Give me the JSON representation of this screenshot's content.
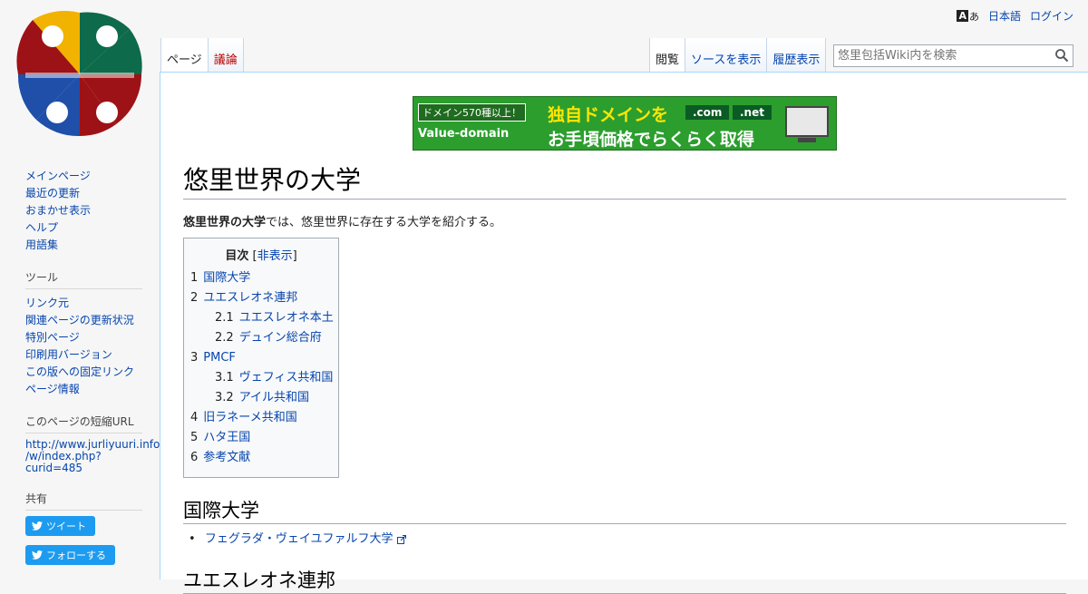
{
  "personal_tools": {
    "language": "日本語",
    "login": "ログイン"
  },
  "tabs": {
    "page": "ページ",
    "talk": "議論",
    "read": "閲覧",
    "view_source": "ソースを表示",
    "history": "履歴表示"
  },
  "search": {
    "placeholder": "悠里包括Wiki内を検索"
  },
  "sidebar": {
    "nav": [
      "メインページ",
      "最近の更新",
      "おまかせ表示",
      "ヘルプ",
      "用語集"
    ],
    "tools_heading": "ツール",
    "tools": [
      "リンク元",
      "関連ページの更新状況",
      "特別ページ",
      "印刷用バージョン",
      "この版への固定リンク",
      "ページ情報"
    ],
    "shorturl_heading": "このページの短縮URL",
    "shorturl": [
      "http://www.jurliyuuri.info",
      "/w/index.php?",
      "curid=485"
    ],
    "share_heading": "共有",
    "tweet": "ツイート",
    "follow": "フォローする"
  },
  "banner": {
    "badge": "ドメイン570種以上！",
    "brand": "Value-domain",
    "headline1": "独自ドメインを",
    "headline2": "お手頃価格でらくらく取得",
    "tld1": ".com",
    "tld2": ".net"
  },
  "article": {
    "title": "悠里世界の大学",
    "intro_bold": "悠里世界の大学",
    "intro_rest": "では、悠里世界に存在する大学を紹介する。",
    "toc_title": "目次",
    "toc_hide": "非表示",
    "toc": [
      {
        "num": "1",
        "label": "国際大学",
        "level": 1
      },
      {
        "num": "2",
        "label": "ユエスレオネ連邦",
        "level": 1
      },
      {
        "num": "2.1",
        "label": "ユエスレオネ本土",
        "level": 2
      },
      {
        "num": "2.2",
        "label": "デュイン総合府",
        "level": 2
      },
      {
        "num": "3",
        "label": "PMCF",
        "level": 1
      },
      {
        "num": "3.1",
        "label": "ヴェフィス共和国",
        "level": 2
      },
      {
        "num": "3.2",
        "label": "アイル共和国",
        "level": 2
      },
      {
        "num": "4",
        "label": "旧ラネーメ共和国",
        "level": 1
      },
      {
        "num": "5",
        "label": "ハタ王国",
        "level": 1
      },
      {
        "num": "6",
        "label": "参考文献",
        "level": 1
      }
    ],
    "section1_title": "国際大学",
    "section1_items": [
      "フェグラダ・ヴェイユファルフ大学"
    ],
    "section2_title": "ユエスレオネ連邦"
  },
  "colors": {
    "link": "#0645ad",
    "new_link": "#ba0000",
    "banner_green": "#2c9e2e",
    "tweet_blue": "#1d9bf0"
  }
}
